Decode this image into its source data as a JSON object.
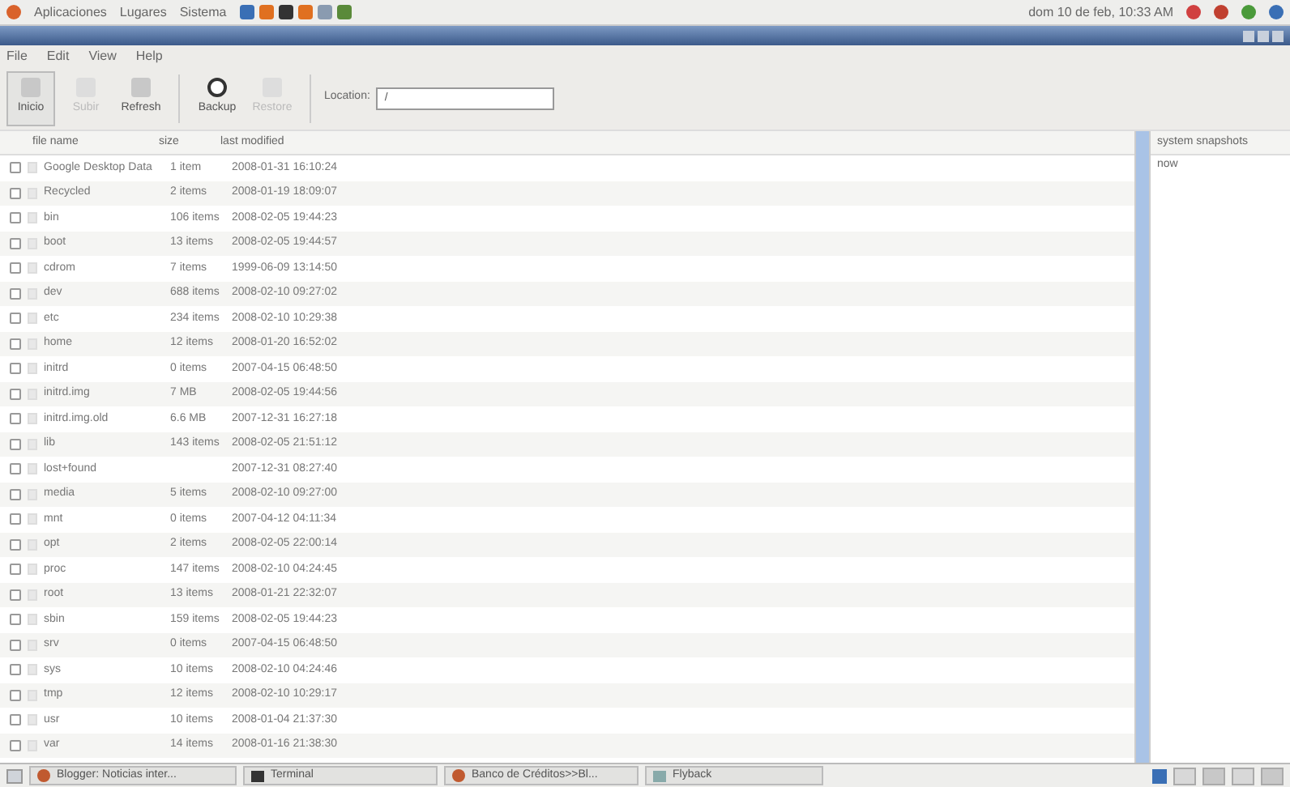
{
  "top_panel": {
    "menus": [
      "Aplicaciones",
      "Lugares",
      "Sistema"
    ],
    "clock": "dom 10 de feb, 10:33 AM"
  },
  "menu_bar": [
    "File",
    "Edit",
    "View",
    "Help"
  ],
  "toolbar": {
    "buttons": [
      {
        "label": "Inicio",
        "disabled": false
      },
      {
        "label": "Subir",
        "disabled": true
      },
      {
        "label": "Refresh",
        "disabled": false
      },
      {
        "label": "Backup",
        "disabled": false
      },
      {
        "label": "Restore",
        "disabled": true
      }
    ],
    "location_label": "Location:",
    "location_value": "/"
  },
  "table": {
    "columns": [
      "file name",
      "size",
      "last modified"
    ],
    "rows": [
      {
        "name": "Google Desktop Data",
        "size": "1 item",
        "modified": "2008-01-31 16:10:24",
        "checked": false
      },
      {
        "name": "Recycled",
        "size": "2 items",
        "modified": "2008-01-19 18:09:07",
        "checked": false
      },
      {
        "name": "bin",
        "size": "106 items",
        "modified": "2008-02-05 19:44:23",
        "checked": false
      },
      {
        "name": "boot",
        "size": "13 items",
        "modified": "2008-02-05 19:44:57",
        "checked": false
      },
      {
        "name": "cdrom",
        "size": "7 items",
        "modified": "1999-06-09 13:14:50",
        "checked": false
      },
      {
        "name": "dev",
        "size": "688 items",
        "modified": "2008-02-10 09:27:02",
        "checked": false
      },
      {
        "name": "etc",
        "size": "234 items",
        "modified": "2008-02-10 10:29:38",
        "checked": false
      },
      {
        "name": "home",
        "size": "12 items",
        "modified": "2008-01-20 16:52:02",
        "checked": false
      },
      {
        "name": "initrd",
        "size": "0 items",
        "modified": "2007-04-15 06:48:50",
        "checked": false
      },
      {
        "name": "initrd.img",
        "size": "7 MB",
        "modified": "2008-02-05 19:44:56",
        "checked": false
      },
      {
        "name": "initrd.img.old",
        "size": "6.6 MB",
        "modified": "2007-12-31 16:27:18",
        "checked": false
      },
      {
        "name": "lib",
        "size": "143 items",
        "modified": "2008-02-05 21:51:12",
        "checked": false
      },
      {
        "name": "lost+found",
        "size": "",
        "modified": "2007-12-31 08:27:40",
        "checked": false
      },
      {
        "name": "media",
        "size": "5 items",
        "modified": "2008-02-10 09:27:00",
        "checked": false
      },
      {
        "name": "mnt",
        "size": "0 items",
        "modified": "2007-04-12 04:11:34",
        "checked": false
      },
      {
        "name": "opt",
        "size": "2 items",
        "modified": "2008-02-05 22:00:14",
        "checked": false
      },
      {
        "name": "proc",
        "size": "147 items",
        "modified": "2008-02-10 04:24:45",
        "checked": false
      },
      {
        "name": "root",
        "size": "13 items",
        "modified": "2008-01-21 22:32:07",
        "checked": false
      },
      {
        "name": "sbin",
        "size": "159 items",
        "modified": "2008-02-05 19:44:23",
        "checked": false
      },
      {
        "name": "srv",
        "size": "0 items",
        "modified": "2007-04-15 06:48:50",
        "checked": false
      },
      {
        "name": "sys",
        "size": "10 items",
        "modified": "2008-02-10 04:24:46",
        "checked": false
      },
      {
        "name": "tmp",
        "size": "12 items",
        "modified": "2008-02-10 10:29:17",
        "checked": false
      },
      {
        "name": "usr",
        "size": "10 items",
        "modified": "2008-01-04 21:37:30",
        "checked": false
      },
      {
        "name": "var",
        "size": "14 items",
        "modified": "2008-01-16 21:38:30",
        "checked": false
      }
    ]
  },
  "snapshots": {
    "header": "system snapshots",
    "items": [
      {
        "label": "now",
        "selected": false
      }
    ]
  },
  "taskbar": [
    {
      "label": "Blogger: Noticias inter...",
      "kind": "browser"
    },
    {
      "label": "Terminal",
      "kind": "terminal"
    },
    {
      "label": "Banco de Créditos>>Bl...",
      "kind": "browser"
    },
    {
      "label": "Flyback",
      "kind": "window"
    }
  ]
}
